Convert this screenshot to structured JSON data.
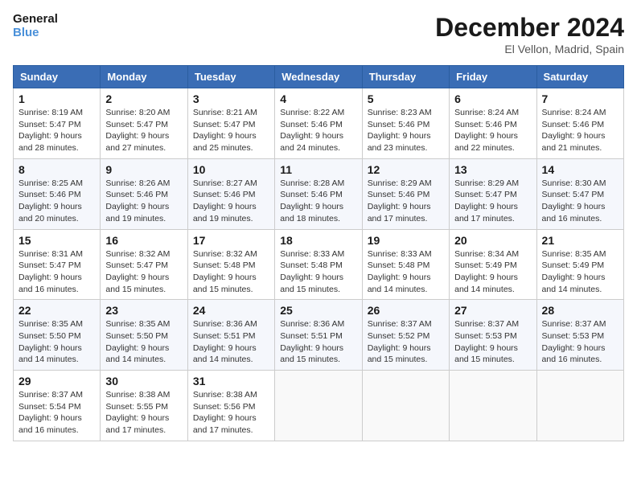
{
  "header": {
    "logo_line1": "General",
    "logo_line2": "Blue",
    "month": "December 2024",
    "location": "El Vellon, Madrid, Spain"
  },
  "weekdays": [
    "Sunday",
    "Monday",
    "Tuesday",
    "Wednesday",
    "Thursday",
    "Friday",
    "Saturday"
  ],
  "weeks": [
    [
      {
        "day": 1,
        "sunrise": "8:19 AM",
        "sunset": "5:47 PM",
        "daylight": "9 hours and 28 minutes."
      },
      {
        "day": 2,
        "sunrise": "8:20 AM",
        "sunset": "5:47 PM",
        "daylight": "9 hours and 27 minutes."
      },
      {
        "day": 3,
        "sunrise": "8:21 AM",
        "sunset": "5:47 PM",
        "daylight": "9 hours and 25 minutes."
      },
      {
        "day": 4,
        "sunrise": "8:22 AM",
        "sunset": "5:46 PM",
        "daylight": "9 hours and 24 minutes."
      },
      {
        "day": 5,
        "sunrise": "8:23 AM",
        "sunset": "5:46 PM",
        "daylight": "9 hours and 23 minutes."
      },
      {
        "day": 6,
        "sunrise": "8:24 AM",
        "sunset": "5:46 PM",
        "daylight": "9 hours and 22 minutes."
      },
      {
        "day": 7,
        "sunrise": "8:24 AM",
        "sunset": "5:46 PM",
        "daylight": "9 hours and 21 minutes."
      }
    ],
    [
      {
        "day": 8,
        "sunrise": "8:25 AM",
        "sunset": "5:46 PM",
        "daylight": "9 hours and 20 minutes."
      },
      {
        "day": 9,
        "sunrise": "8:26 AM",
        "sunset": "5:46 PM",
        "daylight": "9 hours and 19 minutes."
      },
      {
        "day": 10,
        "sunrise": "8:27 AM",
        "sunset": "5:46 PM",
        "daylight": "9 hours and 19 minutes."
      },
      {
        "day": 11,
        "sunrise": "8:28 AM",
        "sunset": "5:46 PM",
        "daylight": "9 hours and 18 minutes."
      },
      {
        "day": 12,
        "sunrise": "8:29 AM",
        "sunset": "5:46 PM",
        "daylight": "9 hours and 17 minutes."
      },
      {
        "day": 13,
        "sunrise": "8:29 AM",
        "sunset": "5:47 PM",
        "daylight": "9 hours and 17 minutes."
      },
      {
        "day": 14,
        "sunrise": "8:30 AM",
        "sunset": "5:47 PM",
        "daylight": "9 hours and 16 minutes."
      }
    ],
    [
      {
        "day": 15,
        "sunrise": "8:31 AM",
        "sunset": "5:47 PM",
        "daylight": "9 hours and 16 minutes."
      },
      {
        "day": 16,
        "sunrise": "8:32 AM",
        "sunset": "5:47 PM",
        "daylight": "9 hours and 15 minutes."
      },
      {
        "day": 17,
        "sunrise": "8:32 AM",
        "sunset": "5:48 PM",
        "daylight": "9 hours and 15 minutes."
      },
      {
        "day": 18,
        "sunrise": "8:33 AM",
        "sunset": "5:48 PM",
        "daylight": "9 hours and 15 minutes."
      },
      {
        "day": 19,
        "sunrise": "8:33 AM",
        "sunset": "5:48 PM",
        "daylight": "9 hours and 14 minutes."
      },
      {
        "day": 20,
        "sunrise": "8:34 AM",
        "sunset": "5:49 PM",
        "daylight": "9 hours and 14 minutes."
      },
      {
        "day": 21,
        "sunrise": "8:35 AM",
        "sunset": "5:49 PM",
        "daylight": "9 hours and 14 minutes."
      }
    ],
    [
      {
        "day": 22,
        "sunrise": "8:35 AM",
        "sunset": "5:50 PM",
        "daylight": "9 hours and 14 minutes."
      },
      {
        "day": 23,
        "sunrise": "8:35 AM",
        "sunset": "5:50 PM",
        "daylight": "9 hours and 14 minutes."
      },
      {
        "day": 24,
        "sunrise": "8:36 AM",
        "sunset": "5:51 PM",
        "daylight": "9 hours and 14 minutes."
      },
      {
        "day": 25,
        "sunrise": "8:36 AM",
        "sunset": "5:51 PM",
        "daylight": "9 hours and 15 minutes."
      },
      {
        "day": 26,
        "sunrise": "8:37 AM",
        "sunset": "5:52 PM",
        "daylight": "9 hours and 15 minutes."
      },
      {
        "day": 27,
        "sunrise": "8:37 AM",
        "sunset": "5:53 PM",
        "daylight": "9 hours and 15 minutes."
      },
      {
        "day": 28,
        "sunrise": "8:37 AM",
        "sunset": "5:53 PM",
        "daylight": "9 hours and 16 minutes."
      }
    ],
    [
      {
        "day": 29,
        "sunrise": "8:37 AM",
        "sunset": "5:54 PM",
        "daylight": "9 hours and 16 minutes."
      },
      {
        "day": 30,
        "sunrise": "8:38 AM",
        "sunset": "5:55 PM",
        "daylight": "9 hours and 17 minutes."
      },
      {
        "day": 31,
        "sunrise": "8:38 AM",
        "sunset": "5:56 PM",
        "daylight": "9 hours and 17 minutes."
      },
      null,
      null,
      null,
      null
    ]
  ],
  "labels": {
    "sunrise": "Sunrise:",
    "sunset": "Sunset:",
    "daylight": "Daylight:"
  }
}
